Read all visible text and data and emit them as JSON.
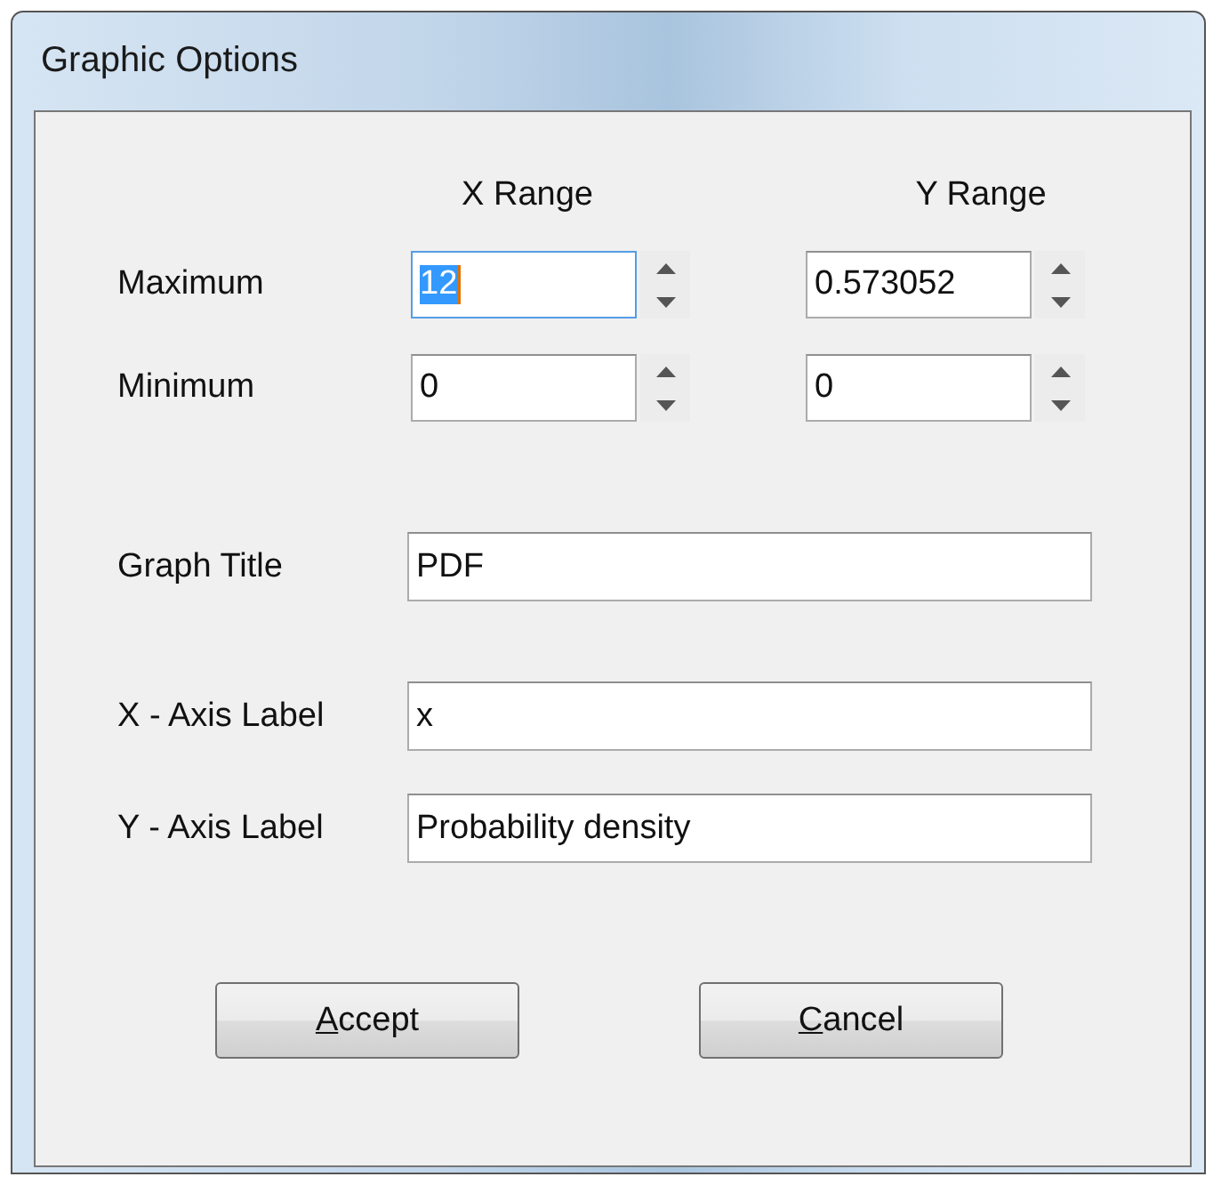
{
  "window": {
    "title": "Graphic Options"
  },
  "range_headers": [
    "X Range",
    "Y Range"
  ],
  "range_rows": [
    {
      "label": "Maximum",
      "fields": [
        {
          "value": "12",
          "focused": true,
          "text_selected": true
        },
        {
          "value": "0.573052",
          "focused": false,
          "text_selected": false
        }
      ]
    },
    {
      "label": "Minimum",
      "fields": [
        {
          "value": "0",
          "focused": false,
          "text_selected": false
        },
        {
          "value": "0",
          "focused": false,
          "text_selected": false
        }
      ]
    }
  ],
  "text_fields": [
    {
      "label": "Graph Title",
      "value": "PDF"
    },
    {
      "label": "X - Axis Label",
      "value": "x"
    },
    {
      "label": "Y - Axis Label",
      "value": "Probability density"
    }
  ],
  "buttons": [
    {
      "label": "Accept",
      "first_letter_underlined": true
    },
    {
      "label": "Cancel",
      "first_letter_underlined": true
    }
  ]
}
